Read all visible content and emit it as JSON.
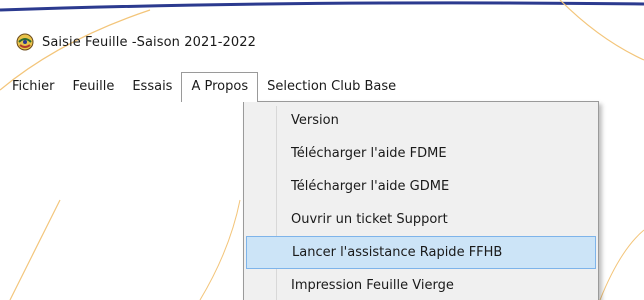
{
  "window": {
    "title": "Saisie Feuille -Saison 2021-2022",
    "icon": "app-logo-icon"
  },
  "menubar": {
    "items": [
      {
        "label": "Fichier"
      },
      {
        "label": "Feuille"
      },
      {
        "label": "Essais"
      },
      {
        "label": "A Propos",
        "open": true
      },
      {
        "label": "Selection Club Base"
      }
    ]
  },
  "dropdown": {
    "items": [
      {
        "label": "Version"
      },
      {
        "label": "Télécharger l'aide FDME"
      },
      {
        "label": "Télécharger l'aide GDME"
      },
      {
        "label": "Ouvrir un ticket Support"
      },
      {
        "label": "Lancer l'assistance Rapide FFHB",
        "highlighted": true
      },
      {
        "label": "Impression Feuille Vierge"
      }
    ]
  },
  "colors": {
    "accent_line": "#2b3a8f",
    "decor_arc": "#f3c57a",
    "highlight_bg": "#cce4f7",
    "highlight_border": "#7eb4ea"
  }
}
